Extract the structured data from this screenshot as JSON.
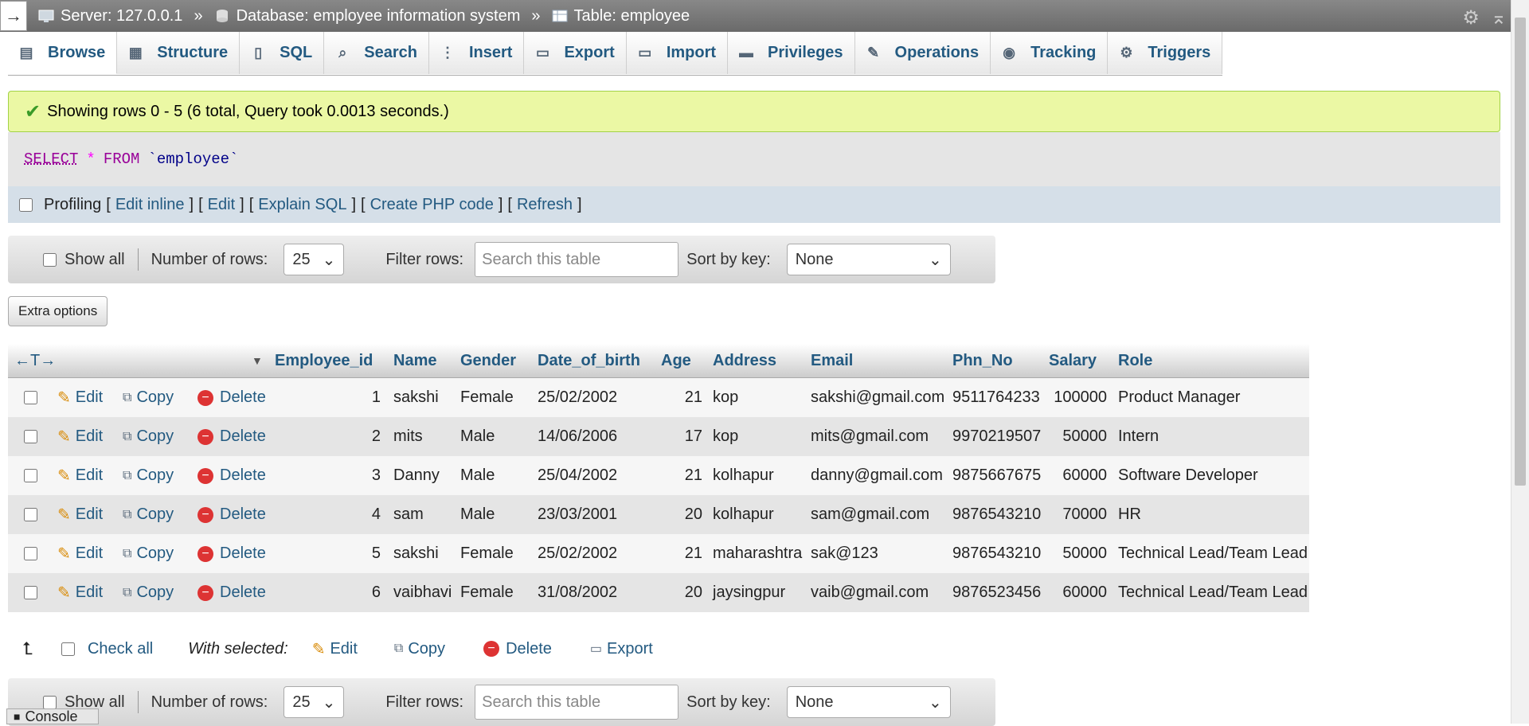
{
  "breadcrumb": {
    "server": "Server: 127.0.0.1",
    "database": "Database: employee information system",
    "table": "Table: employee",
    "sep": "»"
  },
  "tabs": [
    {
      "label": "Browse",
      "icon": "browse-icon"
    },
    {
      "label": "Structure",
      "icon": "structure-icon"
    },
    {
      "label": "SQL",
      "icon": "sql-icon"
    },
    {
      "label": "Search",
      "icon": "search-icon"
    },
    {
      "label": "Insert",
      "icon": "insert-icon"
    },
    {
      "label": "Export",
      "icon": "export-icon"
    },
    {
      "label": "Import",
      "icon": "import-icon"
    },
    {
      "label": "Privileges",
      "icon": "privileges-icon"
    },
    {
      "label": "Operations",
      "icon": "wrench-icon"
    },
    {
      "label": "Tracking",
      "icon": "eye-icon"
    },
    {
      "label": "Triggers",
      "icon": "triggers-icon"
    }
  ],
  "message": "Showing rows 0 - 5 (6 total, Query took 0.0013 seconds.)",
  "sql": {
    "select": "SELECT",
    "star": "*",
    "from": "FROM",
    "table": "`employee`"
  },
  "profiling": {
    "label": "Profiling",
    "open": "[",
    "close": "]",
    "links": [
      "Edit inline",
      "Edit",
      "Explain SQL",
      "Create PHP code",
      "Refresh"
    ]
  },
  "nav": {
    "show_all": "Show all",
    "rows_label": "Number of rows:",
    "rows_value": "25",
    "filter_label": "Filter rows:",
    "filter_placeholder": "Search this table",
    "sort_label": "Sort by key:",
    "sort_value": "None"
  },
  "extra_options": "Extra options",
  "table": {
    "arrows": "←T→",
    "columns": [
      "Employee_id",
      "Name",
      "Gender",
      "Date_of_birth",
      "Age",
      "Address",
      "Email",
      "Phn_No",
      "Salary",
      "Role"
    ],
    "action_labels": {
      "edit": "Edit",
      "copy": "Copy",
      "delete": "Delete"
    },
    "rows": [
      [
        "1",
        "sakshi",
        "Female",
        "25/02/2002",
        "21",
        "kop",
        "sakshi@gmail.com",
        "9511764233",
        "100000",
        "Product Manager"
      ],
      [
        "2",
        "mits",
        "Male",
        "14/06/2006",
        "17",
        "kop",
        "mits@gmail.com",
        "9970219507",
        "50000",
        "Intern"
      ],
      [
        "3",
        "Danny",
        "Male",
        "25/04/2002",
        "21",
        "kolhapur",
        "danny@gmail.com",
        "9875667675",
        "60000",
        "Software Developer"
      ],
      [
        "4",
        "sam",
        "Male",
        "23/03/2001",
        "20",
        "kolhapur",
        "sam@gmail.com",
        "9876543210",
        "70000",
        "HR"
      ],
      [
        "5",
        "sakshi",
        "Female",
        "25/02/2002",
        "21",
        "maharashtra",
        "sak@123",
        "9876543210",
        "50000",
        "Technical Lead/Team Lead"
      ],
      [
        "6",
        "vaibhavi",
        "Female",
        "31/08/2002",
        "20",
        "jaysingpur",
        "vaib@gmail.com",
        "9876523456",
        "60000",
        "Technical Lead/Team Lead"
      ]
    ]
  },
  "bulk": {
    "check_all": "Check all",
    "with_selected": "With selected:",
    "edit": "Edit",
    "copy": "Copy",
    "delete": "Delete",
    "export": "Export"
  },
  "console": "Console"
}
